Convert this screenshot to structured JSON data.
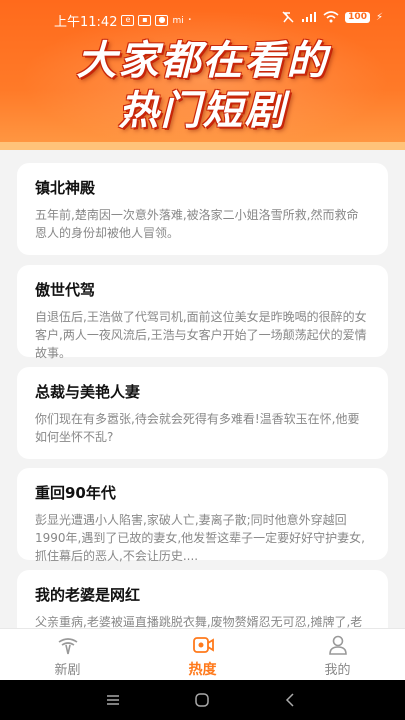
{
  "status_bar": {
    "time": "上午11:42",
    "battery": "100"
  },
  "banner": {
    "title_line1": "大家都在看的",
    "title_line2": "热门短剧"
  },
  "dramas": [
    {
      "title": "镇北神殿",
      "desc": "五年前,楚南因一次意外落难,被洛家二小姐洛雪所救,然而救命恩人的身份却被他人冒领。"
    },
    {
      "title": "傲世代驾",
      "desc": "自退伍后,王浩做了代驾司机,面前这位美女是昨晚喝的很醉的女客户,两人一夜风流后,王浩与女客户开始了一场颠荡起伏的爱情故事。"
    },
    {
      "title": "总裁与美艳人妻",
      "desc": "你们现在有多嚣张,待会就会死得有多难看!温香软玉在怀,他要如何坐怀不乱?"
    },
    {
      "title": "重回90年代",
      "desc": "彭显光遭遇小人陷害,家破人亡,妻离子散;同时他意外穿越回1990年,遇到了已故的妻女,他发誓这辈子一定要好好守护妻女,抓住幕后的恶人,不会让历史...."
    },
    {
      "title": "我的老婆是网红",
      "desc": "父亲重病,老婆被逼直播跳脱衣舞,废物赘婿忍无可忍,摊牌了,老子是战神!"
    }
  ],
  "bottom_nav": {
    "items": [
      {
        "label": "新剧",
        "icon": "new-drama-icon"
      },
      {
        "label": "热度",
        "icon": "hot-video-icon"
      },
      {
        "label": "我的",
        "icon": "profile-icon"
      }
    ],
    "active_index": 1,
    "active_color": "#ff7a1c",
    "inactive_color": "#888888"
  },
  "colors": {
    "header": "#ff6a1c",
    "background": "#f3f3f3"
  }
}
